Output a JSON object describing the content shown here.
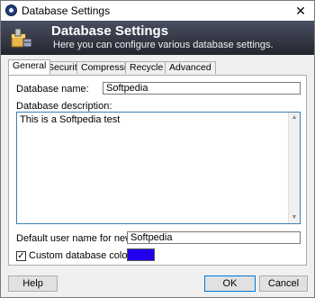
{
  "window": {
    "title": "Database Settings",
    "close_glyph": "✕"
  },
  "banner": {
    "title": "Database Settings",
    "subtitle": "Here you can configure various database settings."
  },
  "tabs": [
    {
      "label": "General"
    },
    {
      "label": "Security"
    },
    {
      "label": "Compression"
    },
    {
      "label": "Recycle Bin"
    },
    {
      "label": "Advanced"
    }
  ],
  "general": {
    "db_name_label": "Database name:",
    "db_name_value": "Softpedia",
    "db_desc_label": "Database description:",
    "db_desc_value": "This is a Softpedia test",
    "default_user_label": "Default user name for new entries:",
    "default_user_value": "Softpedia",
    "custom_color_label": "Custom database color:",
    "custom_color_checked": "✓",
    "custom_color": "#2200ee"
  },
  "buttons": {
    "help": "Help",
    "ok": "OK",
    "cancel": "Cancel"
  }
}
